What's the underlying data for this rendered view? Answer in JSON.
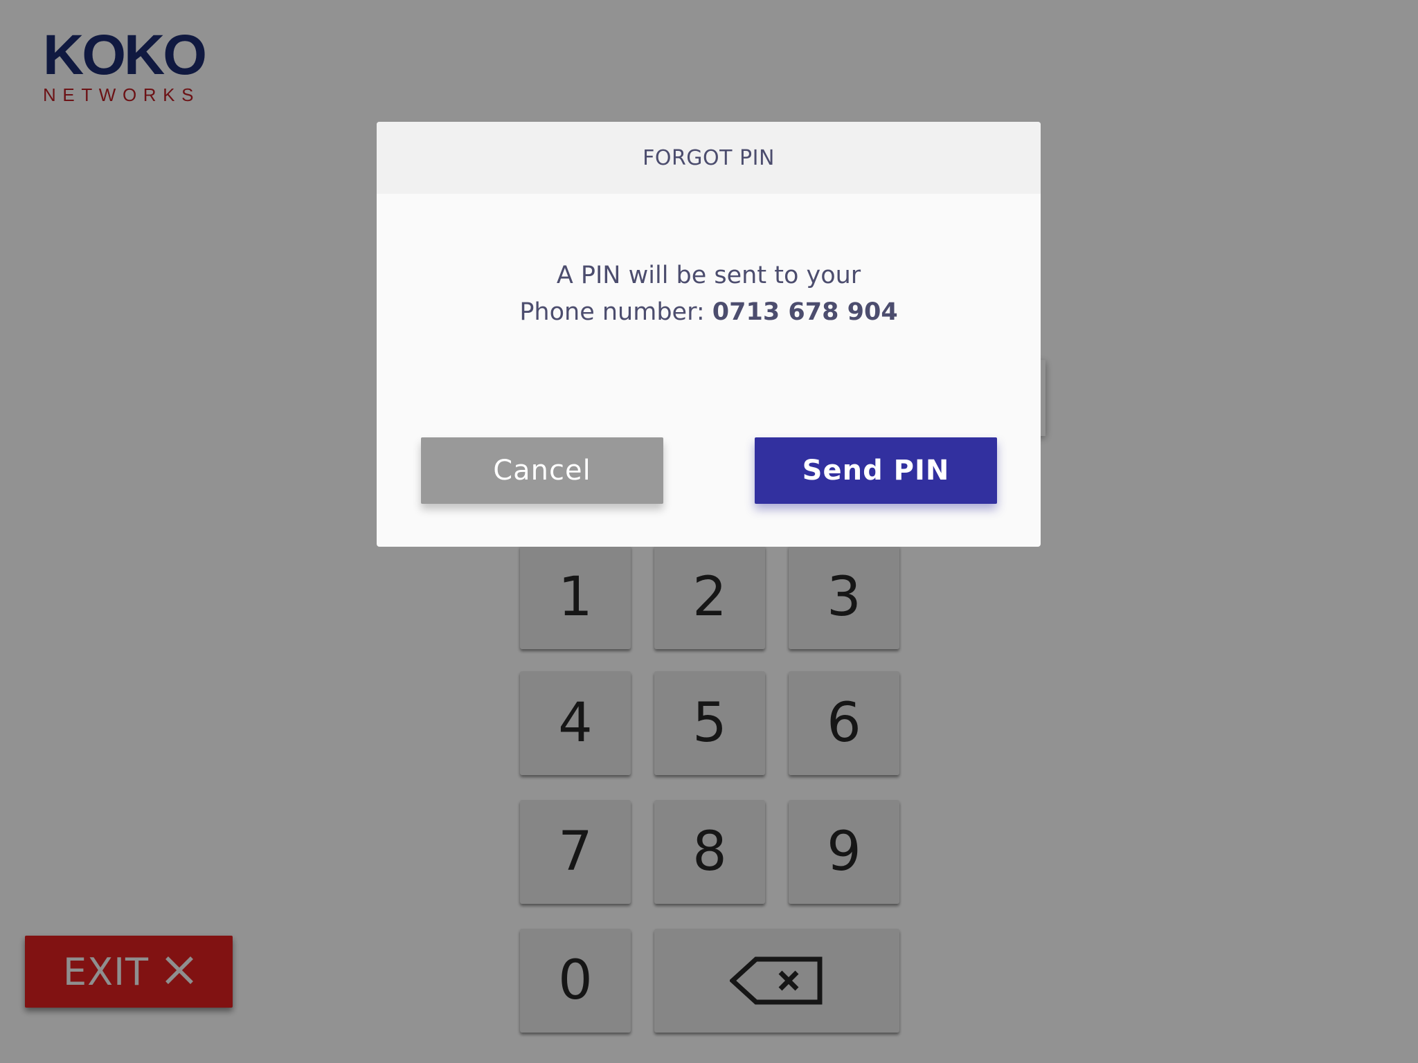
{
  "logo": {
    "main": "KOKO",
    "sub": "NETWORKS"
  },
  "keypad": {
    "keys": [
      "1",
      "2",
      "3",
      "4",
      "5",
      "6",
      "7",
      "8",
      "9",
      "0"
    ],
    "backspace_icon": "backspace-icon"
  },
  "exit": {
    "label": "EXIT",
    "icon": "close-icon"
  },
  "dialog": {
    "title": "FORGOT PIN",
    "message_line1": "A PIN will be sent to your",
    "message_line2_prefix": "Phone number: ",
    "phone_number": "0713 678 904",
    "cancel_label": "Cancel",
    "send_label": "Send PIN"
  },
  "colors": {
    "brand_navy": "#1b2a6b",
    "brand_red": "#b41e24",
    "exit_red": "#d71f1f",
    "primary_button": "#32309f",
    "secondary_button": "#999999",
    "dialog_text": "#4c4d6e"
  }
}
